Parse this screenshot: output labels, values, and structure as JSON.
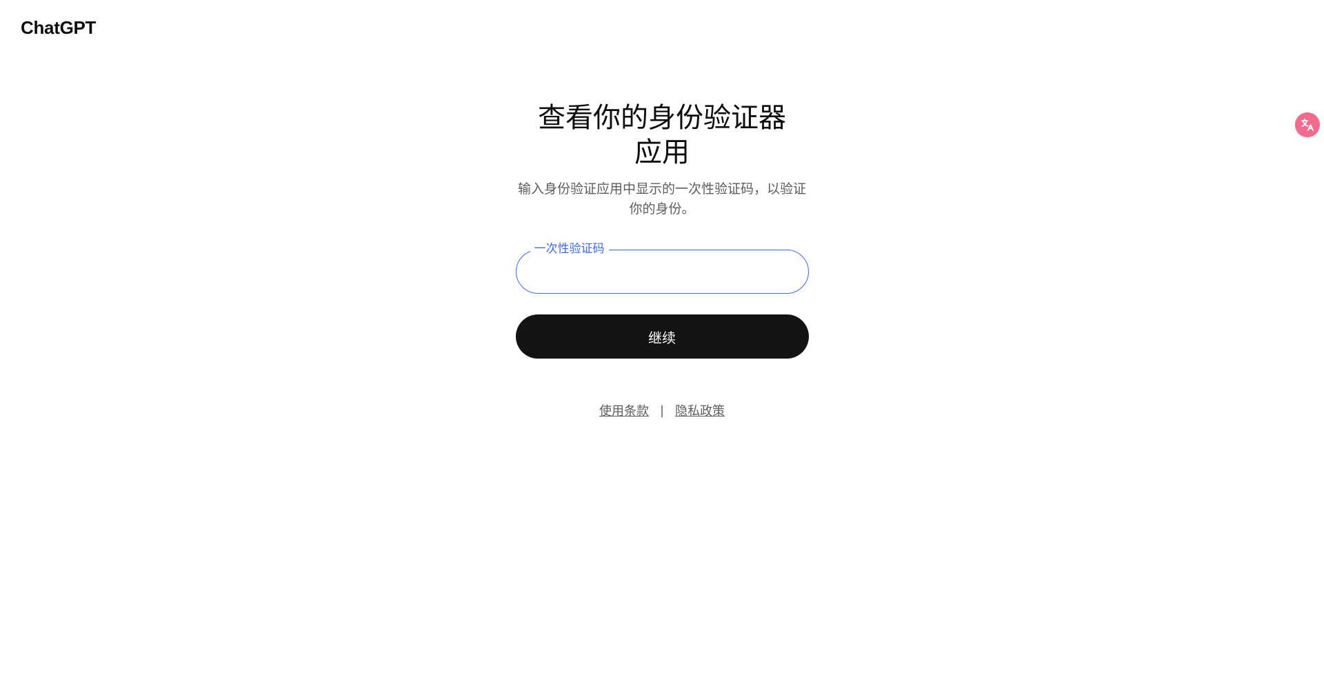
{
  "header": {
    "logo_text": "ChatGPT"
  },
  "main": {
    "title": "查看你的身份验证器应用",
    "subtitle": "输入身份验证应用中显示的一次性验证码，以验证你的身份。",
    "code_field": {
      "label": "一次性验证码",
      "value": ""
    },
    "continue_label": "继续"
  },
  "footer": {
    "terms_label": "使用条款",
    "separator": "|",
    "privacy_label": "隐私政策"
  },
  "floating": {
    "translate_icon": "translate-icon",
    "accent_color": "#f06b8d"
  },
  "colors": {
    "accent": "#3e68ff",
    "button_bg": "#131313"
  }
}
